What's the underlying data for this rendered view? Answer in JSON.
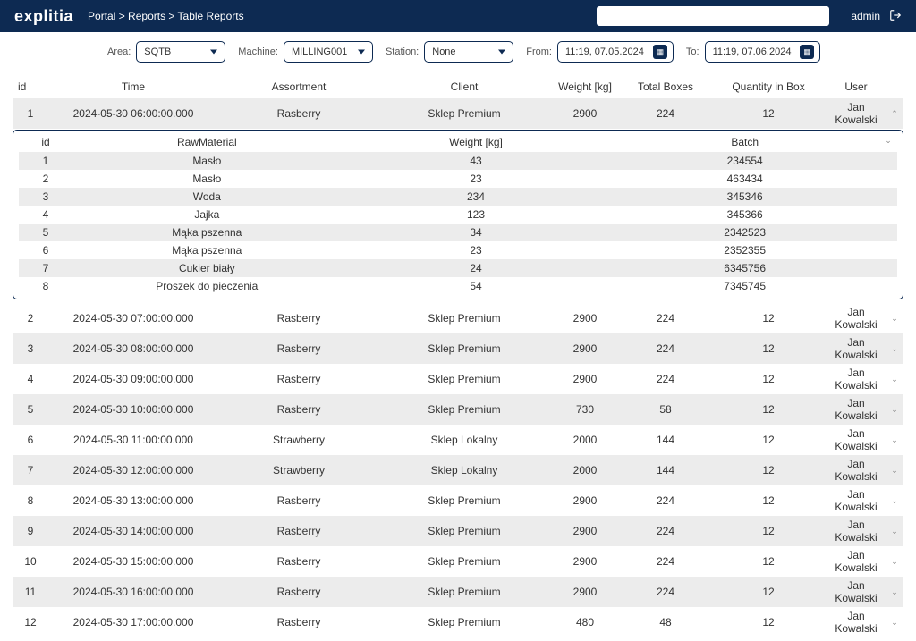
{
  "header": {
    "logo": "explitia",
    "breadcrumb": "Portal > Reports > Table Reports",
    "user": "admin"
  },
  "filters": {
    "area": {
      "label": "Area:",
      "value": "SQTB"
    },
    "machine": {
      "label": "Machine:",
      "value": "MILLING001"
    },
    "station": {
      "label": "Station:",
      "value": "None"
    },
    "from": {
      "label": "From:",
      "value": "11:19, 07.05.2024"
    },
    "to": {
      "label": "To:",
      "value": "11:19, 07.06.2024"
    }
  },
  "columns": {
    "id": "id",
    "time": "Time",
    "assortment": "Assortment",
    "client": "Client",
    "weight": "Weight [kg]",
    "boxes": "Total Boxes",
    "qty": "Quantity in Box",
    "user": "User"
  },
  "rows": [
    {
      "id": "1",
      "time": "2024-05-30 06:00:00.000",
      "assortment": "Rasberry",
      "client": "Sklep Premium",
      "weight": "2900",
      "boxes": "224",
      "qty": "12",
      "user": "Jan Kowalski",
      "expanded": true
    },
    {
      "id": "2",
      "time": "2024-05-30 07:00:00.000",
      "assortment": "Rasberry",
      "client": "Sklep Premium",
      "weight": "2900",
      "boxes": "224",
      "qty": "12",
      "user": "Jan Kowalski"
    },
    {
      "id": "3",
      "time": "2024-05-30 08:00:00.000",
      "assortment": "Rasberry",
      "client": "Sklep Premium",
      "weight": "2900",
      "boxes": "224",
      "qty": "12",
      "user": "Jan Kowalski"
    },
    {
      "id": "4",
      "time": "2024-05-30 09:00:00.000",
      "assortment": "Rasberry",
      "client": "Sklep Premium",
      "weight": "2900",
      "boxes": "224",
      "qty": "12",
      "user": "Jan Kowalski"
    },
    {
      "id": "5",
      "time": "2024-05-30 10:00:00.000",
      "assortment": "Rasberry",
      "client": "Sklep Premium",
      "weight": "730",
      "boxes": "58",
      "qty": "12",
      "user": "Jan Kowalski"
    },
    {
      "id": "6",
      "time": "2024-05-30 11:00:00.000",
      "assortment": "Strawberry",
      "client": "Sklep Lokalny",
      "weight": "2000",
      "boxes": "144",
      "qty": "12",
      "user": "Jan Kowalski"
    },
    {
      "id": "7",
      "time": "2024-05-30 12:00:00.000",
      "assortment": "Strawberry",
      "client": "Sklep Lokalny",
      "weight": "2000",
      "boxes": "144",
      "qty": "12",
      "user": "Jan Kowalski"
    },
    {
      "id": "8",
      "time": "2024-05-30 13:00:00.000",
      "assortment": "Rasberry",
      "client": "Sklep Premium",
      "weight": "2900",
      "boxes": "224",
      "qty": "12",
      "user": "Jan Kowalski"
    },
    {
      "id": "9",
      "time": "2024-05-30 14:00:00.000",
      "assortment": "Rasberry",
      "client": "Sklep Premium",
      "weight": "2900",
      "boxes": "224",
      "qty": "12",
      "user": "Jan Kowalski"
    },
    {
      "id": "10",
      "time": "2024-05-30 15:00:00.000",
      "assortment": "Rasberry",
      "client": "Sklep Premium",
      "weight": "2900",
      "boxes": "224",
      "qty": "12",
      "user": "Jan Kowalski"
    },
    {
      "id": "11",
      "time": "2024-05-30 16:00:00.000",
      "assortment": "Rasberry",
      "client": "Sklep Premium",
      "weight": "2900",
      "boxes": "224",
      "qty": "12",
      "user": "Jan Kowalski"
    },
    {
      "id": "12",
      "time": "2024-05-30 17:00:00.000",
      "assortment": "Rasberry",
      "client": "Sklep Premium",
      "weight": "480",
      "boxes": "48",
      "qty": "12",
      "user": "Jan Kowalski"
    }
  ],
  "detail": {
    "columns": {
      "id": "id",
      "raw": "RawMaterial",
      "weight": "Weight [kg]",
      "batch": "Batch"
    },
    "rows": [
      {
        "id": "1",
        "raw": "Masło",
        "weight": "43",
        "batch": "234554"
      },
      {
        "id": "2",
        "raw": "Masło",
        "weight": "23",
        "batch": "463434"
      },
      {
        "id": "3",
        "raw": "Woda",
        "weight": "234",
        "batch": "345346"
      },
      {
        "id": "4",
        "raw": "Jajka",
        "weight": "123",
        "batch": "345366"
      },
      {
        "id": "5",
        "raw": "Mąka pszenna",
        "weight": "34",
        "batch": "2342523"
      },
      {
        "id": "6",
        "raw": "Mąka pszenna",
        "weight": "23",
        "batch": "2352355"
      },
      {
        "id": "7",
        "raw": "Cukier biały",
        "weight": "24",
        "batch": "6345756"
      },
      {
        "id": "8",
        "raw": "Proszek do pieczenia",
        "weight": "54",
        "batch": "7345745"
      }
    ]
  }
}
